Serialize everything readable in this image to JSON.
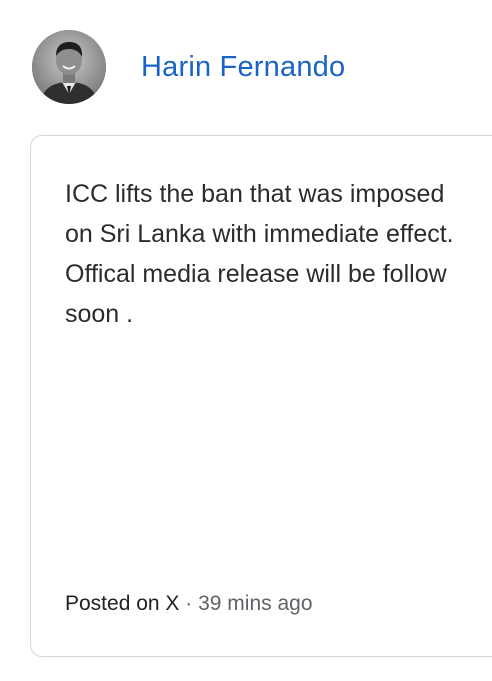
{
  "author": {
    "name": "Harin Fernando",
    "avatar_icon": "person-photo-avatar"
  },
  "post": {
    "text": "ICC lifts the ban that was imposed on Sri Lanka with immediate effect. Offical media release will be follow soon .",
    "platform_label": "Posted on X",
    "separator": " · ",
    "time_ago": "39 mins ago"
  },
  "colors": {
    "author_link": "#1a63c7",
    "card_border": "#d6d6d6",
    "body_text": "#2c2c2c",
    "meta_text": "#5f6368"
  }
}
